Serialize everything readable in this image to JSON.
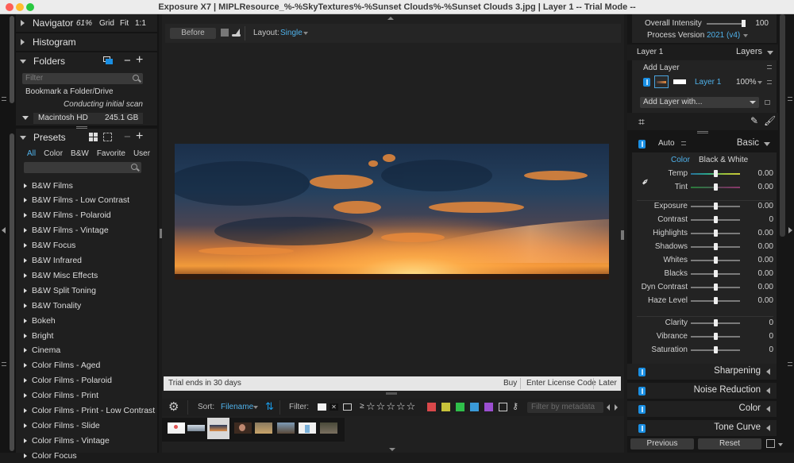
{
  "window": {
    "title": "Exposure X7 | MIPLResource_%-%SkyTextures%-%Sunset Clouds%-%Sunset Clouds 3.jpg | Layer 1 -- Trial Mode --"
  },
  "left_panel": {
    "navigator": {
      "label": "Navigator",
      "zoom": "61%",
      "grid": "Grid",
      "fit": "Fit",
      "one_to_one": "1:1"
    },
    "histogram": {
      "label": "Histogram"
    },
    "folders": {
      "label": "Folders",
      "filter_placeholder": "Filter",
      "bookmark": "Bookmark a Folder/Drive",
      "status": "Conducting initial scan",
      "drive": {
        "name": "Macintosh HD",
        "size": "245.1 GB"
      }
    },
    "presets": {
      "label": "Presets",
      "tabs": [
        "All",
        "Color",
        "B&W",
        "Favorite",
        "User"
      ],
      "active_tab": "All",
      "items": [
        "B&W Films",
        "B&W Films - Low Contrast",
        "B&W Films - Polaroid",
        "B&W Films - Vintage",
        "B&W Focus",
        "B&W Infrared",
        "B&W Misc Effects",
        "B&W Split Toning",
        "B&W Tonality",
        "Bokeh",
        "Bright",
        "Cinema",
        "Color Films - Aged",
        "Color Films - Polaroid",
        "Color Films - Print",
        "Color Films - Print - Low Contrast",
        "Color Films - Slide",
        "Color Films - Vintage",
        "Color Focus"
      ]
    }
  },
  "center": {
    "before_label": "Before",
    "layout_label": "Layout:",
    "layout_value": "Single",
    "trial": {
      "message": "Trial ends in 30 days",
      "buy": "Buy",
      "license": "Enter License Code",
      "later": "Later"
    },
    "filmstrip": {
      "sort_label": "Sort:",
      "sort_value": "Filename",
      "filter_label": "Filter:",
      "rating_prefix": "≥",
      "stars": 5,
      "color_labels": [
        "#d9484a",
        "#c7c23a",
        "#2fbf4a",
        "#3a9ad8",
        "#9b4fd0"
      ],
      "metadata_placeholder": "Filter by metadata",
      "thumbnail_count": 8,
      "selected_thumbnail": 3
    }
  },
  "right_panel": {
    "overall_intensity": {
      "label": "Overall Intensity",
      "value": "100",
      "fraction": 1.0
    },
    "process_version": {
      "label": "Process Version",
      "value": "2021 (v4)"
    },
    "layer_title": "Layer 1",
    "layers_menu": "Layers",
    "add_layer": "Add Layer",
    "layer": {
      "name": "Layer 1",
      "opacity": "100%"
    },
    "add_layer_with": "Add Layer with...",
    "basic": {
      "auto": "Auto",
      "title": "Basic",
      "modes": [
        "Color",
        "Black & White"
      ],
      "active_mode": "Color",
      "sliders_color": [
        {
          "label": "Temp",
          "value": "0.00",
          "fraction": 0.5
        },
        {
          "label": "Tint",
          "value": "0.00",
          "fraction": 0.5
        }
      ],
      "sliders_tone": [
        {
          "label": "Exposure",
          "value": "0.00",
          "fraction": 0.5
        },
        {
          "label": "Contrast",
          "value": "0",
          "fraction": 0.5
        },
        {
          "label": "Highlights",
          "value": "0.00",
          "fraction": 0.5
        },
        {
          "label": "Shadows",
          "value": "0.00",
          "fraction": 0.5
        },
        {
          "label": "Whites",
          "value": "0.00",
          "fraction": 0.5
        },
        {
          "label": "Blacks",
          "value": "0.00",
          "fraction": 0.5
        },
        {
          "label": "Dyn Contrast",
          "value": "0.00",
          "fraction": 0.5
        },
        {
          "label": "Haze Level",
          "value": "0.00",
          "fraction": 0.5
        }
      ],
      "sliders_presence": [
        {
          "label": "Clarity",
          "value": "0",
          "fraction": 0.5
        },
        {
          "label": "Vibrance",
          "value": "0",
          "fraction": 0.5
        },
        {
          "label": "Saturation",
          "value": "0",
          "fraction": 0.5
        }
      ]
    },
    "sections": [
      "Sharpening",
      "Noise Reduction",
      "Color",
      "Tone Curve"
    ],
    "previous": "Previous",
    "reset": "Reset"
  }
}
